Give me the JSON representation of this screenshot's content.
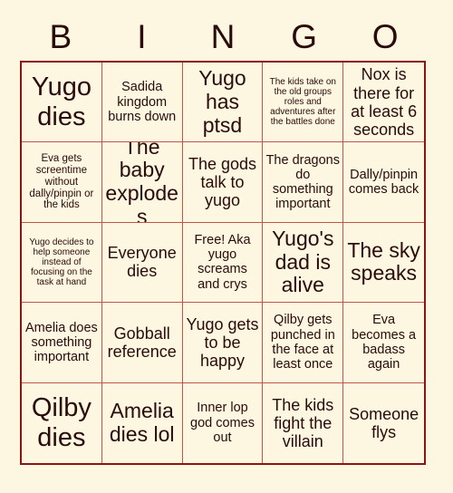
{
  "card": {
    "title": "BINGO",
    "header_letters": [
      "B",
      "I",
      "N",
      "G",
      "O"
    ],
    "colors": {
      "background": "#fdf6e0",
      "text": "#2b0a0a",
      "outer_border": "#8b1512",
      "inner_border": "#c4544a"
    },
    "grid": {
      "columns": 5,
      "rows": 5,
      "free_space_index": 12,
      "cells": [
        {
          "text": "Yugo dies",
          "size": "fs-xl"
        },
        {
          "text": "Sadida kingdom burns down",
          "size": "fs-sm"
        },
        {
          "text": "Yugo has ptsd",
          "size": "fs-lg"
        },
        {
          "text": "The kids take on the old groups roles and adventures after the battles done",
          "size": "fs-xxs"
        },
        {
          "text": "Nox is there for at least 6 seconds",
          "size": "fs-md"
        },
        {
          "text": "Eva gets screentime without dally/pinpin or the kids",
          "size": "fs-xs"
        },
        {
          "text": "The baby explodes",
          "size": "fs-lg"
        },
        {
          "text": "The gods talk to yugo",
          "size": "fs-md"
        },
        {
          "text": "The dragons do something important",
          "size": "fs-sm"
        },
        {
          "text": "Dally/pinpin comes back",
          "size": "fs-sm"
        },
        {
          "text": "Yugo decides to help someone instead of focusing on the task at hand",
          "size": "fs-xxs"
        },
        {
          "text": "Everyone dies",
          "size": "fs-md"
        },
        {
          "text": "Free! Aka yugo screams and crys",
          "size": "fs-sm"
        },
        {
          "text": "Yugo's dad is alive",
          "size": "fs-lg"
        },
        {
          "text": "The sky speaks",
          "size": "fs-lg"
        },
        {
          "text": "Amelia does something important",
          "size": "fs-sm"
        },
        {
          "text": "Gobball reference",
          "size": "fs-md"
        },
        {
          "text": "Yugo gets to be happy",
          "size": "fs-md"
        },
        {
          "text": "Qilby gets punched in the face at least once",
          "size": "fs-sm"
        },
        {
          "text": "Eva becomes a badass again",
          "size": "fs-sm"
        },
        {
          "text": "Qilby dies",
          "size": "fs-xl"
        },
        {
          "text": "Amelia dies lol",
          "size": "fs-lg"
        },
        {
          "text": "Inner lop god comes out",
          "size": "fs-sm"
        },
        {
          "text": "The kids fight the villain",
          "size": "fs-md"
        },
        {
          "text": "Someone flys",
          "size": "fs-md"
        }
      ]
    }
  }
}
